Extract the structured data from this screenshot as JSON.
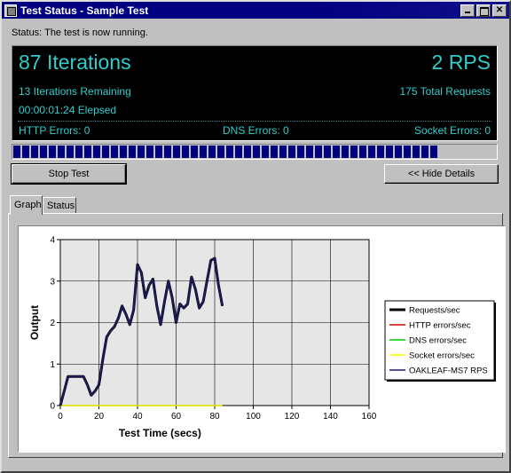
{
  "window": {
    "title": "Test Status - Sample Test"
  },
  "status_text": "Status: The test is now running.",
  "dashboard": {
    "iterations": "87 Iterations",
    "rps": "2 RPS",
    "remaining": "13 Iterations Remaining",
    "total_requests": "175 Total Requests",
    "elapsed": "00:00:01:24 Elepsed",
    "http_errors": "HTTP Errors: 0",
    "dns_errors": "DNS Errors: 0",
    "socket_errors": "Socket Errors: 0",
    "text_color": "#33cccc"
  },
  "progress": {
    "fraction": 0.88,
    "color": "#000080"
  },
  "buttons": {
    "stop": "Stop Test",
    "hide": "<< Hide Details"
  },
  "tabs": [
    {
      "label": "Graph",
      "active": true
    },
    {
      "label": "Status",
      "active": false
    }
  ],
  "chart_data": {
    "type": "line",
    "title": "",
    "xlabel": "Test Time (secs)",
    "ylabel": "Output",
    "xlim": [
      0,
      160
    ],
    "ylim": [
      0,
      4
    ],
    "x_ticks": [
      "0",
      "20",
      "40",
      "60",
      "80",
      "100",
      "120",
      "140",
      "160"
    ],
    "y_ticks": [
      "0",
      "1",
      "2",
      "3",
      "4"
    ],
    "grid": true,
    "legend_position": "right",
    "series": [
      {
        "name": "Requests/sec",
        "color": "#000000",
        "x": [
          0,
          2,
          4,
          6,
          8,
          10,
          12,
          14,
          16,
          18,
          20,
          22,
          24,
          26,
          28,
          30,
          32,
          34,
          36,
          38,
          40,
          42,
          44,
          46,
          48,
          50,
          52,
          54,
          56,
          58,
          60,
          62,
          64,
          66,
          68,
          70,
          72,
          74,
          76,
          78,
          80,
          82,
          84
        ],
        "values": [
          0,
          0.35,
          0.7,
          0.7,
          0.7,
          0.7,
          0.7,
          0.5,
          0.25,
          0.35,
          0.5,
          1.1,
          1.65,
          1.8,
          1.9,
          2.1,
          2.4,
          2.2,
          1.95,
          2.3,
          3.4,
          3.2,
          2.6,
          2.9,
          3.05,
          2.4,
          1.95,
          2.5,
          3.0,
          2.6,
          2.0,
          2.45,
          2.35,
          2.45,
          3.1,
          2.8,
          2.35,
          2.5,
          3.0,
          3.5,
          3.55,
          2.9,
          2.4
        ]
      },
      {
        "name": "HTTP errors/sec",
        "color": "#cc0000",
        "x": [
          0,
          84
        ],
        "values": [
          0,
          0
        ]
      },
      {
        "name": "DNS errors/sec",
        "color": "#00cc00",
        "x": [
          0,
          84
        ],
        "values": [
          0,
          0
        ]
      },
      {
        "name": "Socket errors/sec",
        "color": "#ffff00",
        "x": [
          0,
          84
        ],
        "values": [
          0,
          0
        ]
      },
      {
        "name": "OAKLEAF-MS7 RPS",
        "color": "#1c1c5c",
        "x": [
          0,
          2,
          4,
          6,
          8,
          10,
          12,
          14,
          16,
          18,
          20,
          22,
          24,
          26,
          28,
          30,
          32,
          34,
          36,
          38,
          40,
          42,
          44,
          46,
          48,
          50,
          52,
          54,
          56,
          58,
          60,
          62,
          64,
          66,
          68,
          70,
          72,
          74,
          76,
          78,
          80,
          82,
          84
        ],
        "values": [
          0,
          0.35,
          0.7,
          0.7,
          0.7,
          0.7,
          0.7,
          0.5,
          0.25,
          0.35,
          0.5,
          1.1,
          1.65,
          1.8,
          1.9,
          2.1,
          2.4,
          2.2,
          1.95,
          2.3,
          3.4,
          3.2,
          2.6,
          2.9,
          3.05,
          2.4,
          1.95,
          2.5,
          3.0,
          2.6,
          2.0,
          2.45,
          2.35,
          2.45,
          3.1,
          2.8,
          2.35,
          2.5,
          3.0,
          3.5,
          3.55,
          2.9,
          2.4
        ]
      }
    ]
  }
}
